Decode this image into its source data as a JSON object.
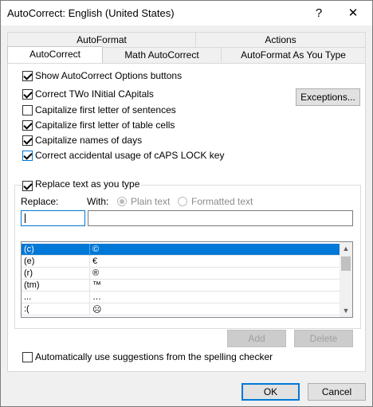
{
  "window": {
    "title": "AutoCorrect: English (United States)",
    "help": "?",
    "close": "✕"
  },
  "tabs": {
    "back_row": [
      "AutoFormat",
      "Actions"
    ],
    "front_row": [
      "AutoCorrect",
      "Math AutoCorrect",
      "AutoFormat As You Type"
    ],
    "active": "AutoCorrect"
  },
  "options": {
    "show_buttons": "Show AutoCorrect Options buttons",
    "two_initial": "Correct TWo INitial CApitals",
    "first_sentence": "Capitalize first letter of sentences",
    "first_table": "Capitalize first letter of table cells",
    "names_days": "Capitalize names of days",
    "caps_lock": "Correct accidental usage of cAPS LOCK key"
  },
  "exceptions_button": "Exceptions...",
  "replace_group": {
    "replace_as_type": "Replace text as you type",
    "replace_label": "Replace:",
    "with_label": "With:",
    "plain_text": "Plain text",
    "formatted_text": "Formatted text"
  },
  "entries": [
    {
      "from": "(c)",
      "to": "©"
    },
    {
      "from": "(e)",
      "to": "€"
    },
    {
      "from": "(r)",
      "to": "®"
    },
    {
      "from": "(tm)",
      "to": "™"
    },
    {
      "from": "...",
      "to": "…"
    },
    {
      "from": ":(",
      "to": "☹"
    }
  ],
  "add_button": "Add",
  "delete_button": "Delete",
  "suggestions": "Automatically use suggestions from the spelling checker",
  "ok_button": "OK",
  "cancel_button": "Cancel"
}
